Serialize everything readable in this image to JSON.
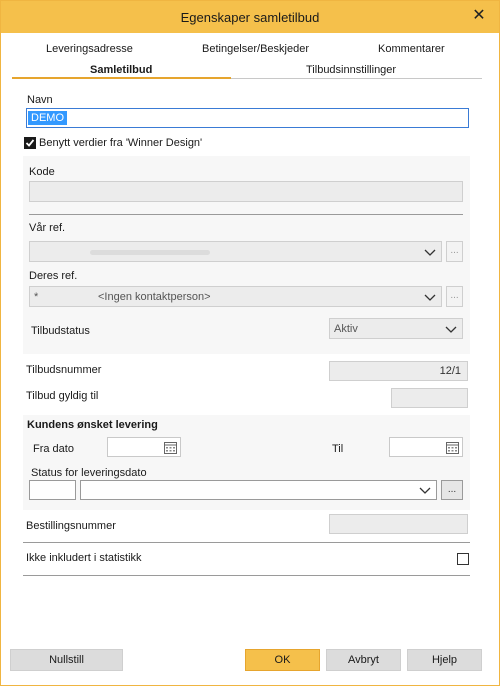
{
  "window": {
    "title": "Egenskaper samletilbud",
    "close_glyph": "✕"
  },
  "tabs": {
    "row1": [
      "Leveringsadresse",
      "Betingelser/Beskjeder",
      "Kommentarer"
    ],
    "row2": [
      "Samletilbud",
      "Tilbudsinnstillinger"
    ],
    "active": "Samletilbud"
  },
  "form": {
    "navn_label": "Navn",
    "navn_value": "DEMO",
    "benytt_label": "Benytt verdier fra 'Winner Design'",
    "benytt_checked": true,
    "kode_label": "Kode",
    "var_ref_label": "Vår ref.",
    "deres_ref_label": "Deres ref.",
    "deres_ref_prefix": "*",
    "deres_ref_value": "<Ingen kontaktperson>",
    "tilbudstatus_label": "Tilbudstatus",
    "tilbudstatus_value": "Aktiv",
    "tilbudsnummer_label": "Tilbudsnummer",
    "tilbudsnummer_value": "12/1",
    "gyldig_label": "Tilbud gyldig til",
    "onsket_heading": "Kundens ønsket levering",
    "fra_dato_label": "Fra dato",
    "til_label": "Til",
    "status_label": "Status for leveringsdato",
    "bestillingsnummer_label": "Bestillingsnummer",
    "statistikk_label": "Ikke inkludert i statistikk",
    "statistikk_checked": false,
    "dots": "..."
  },
  "buttons": {
    "reset": "Nullstill",
    "ok": "OK",
    "cancel": "Avbryt",
    "help": "Hjelp"
  },
  "colors": {
    "accent": "#f5c04b",
    "selection": "#3399ff"
  }
}
